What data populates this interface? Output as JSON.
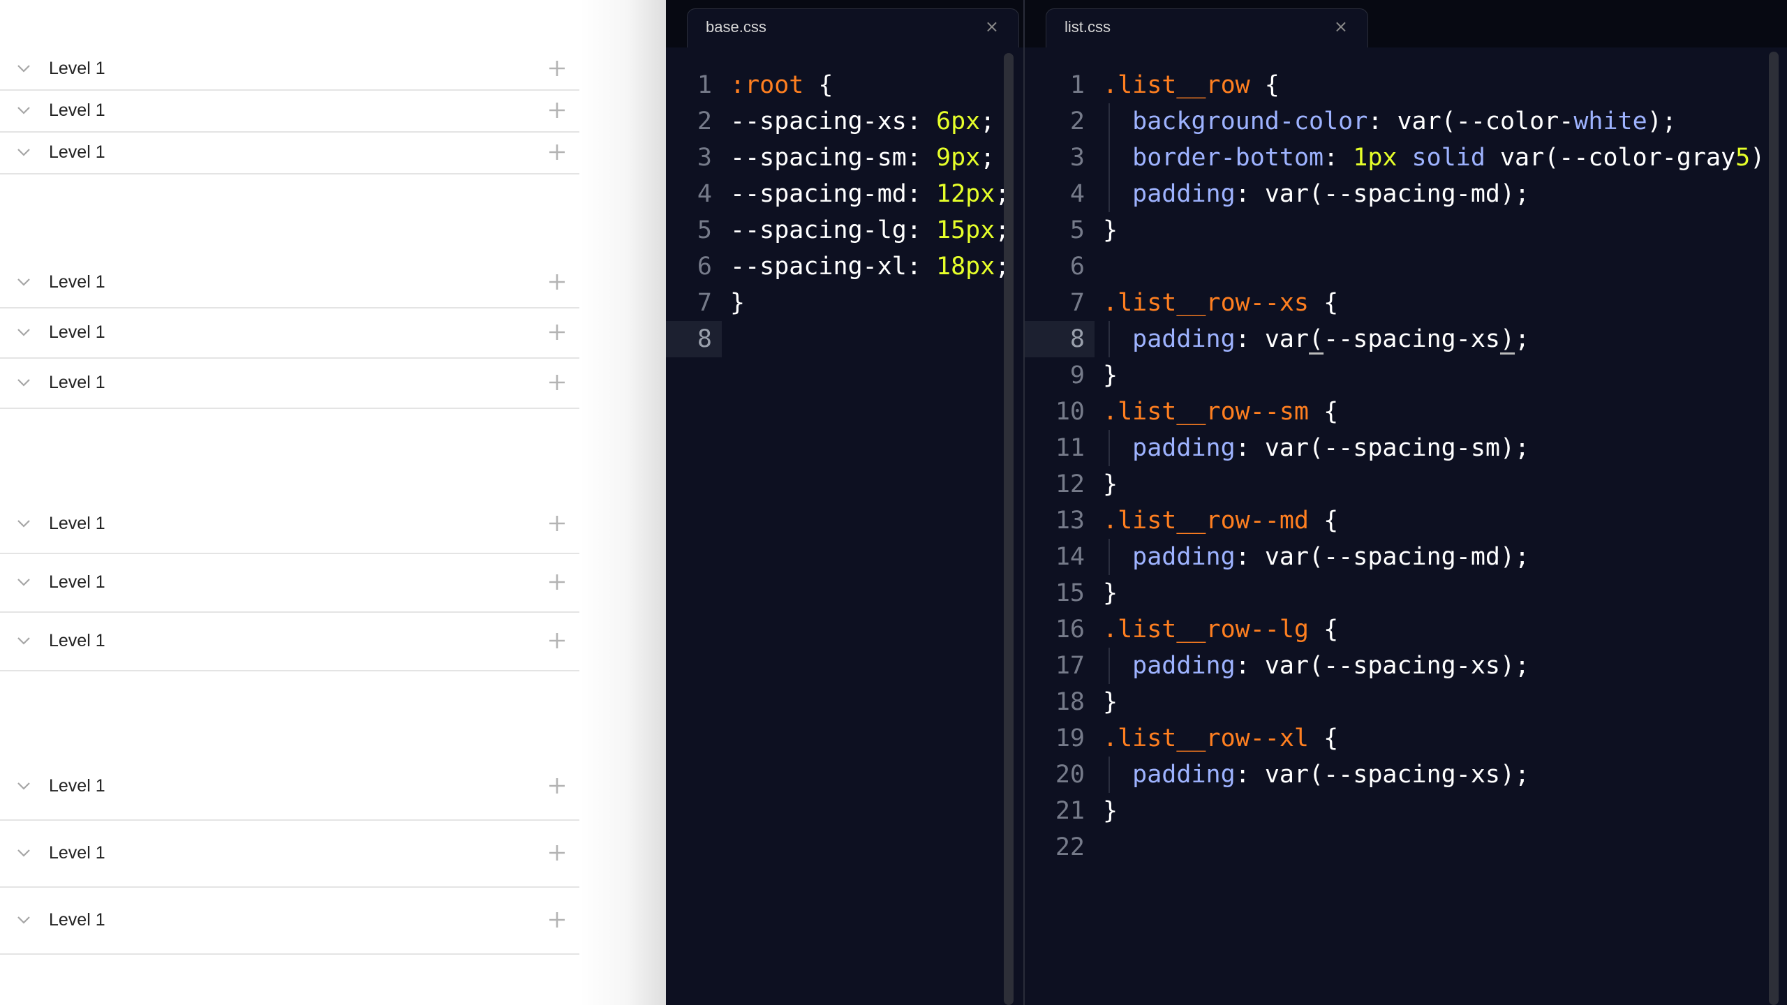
{
  "preview": {
    "groups": [
      {
        "size": "xs",
        "rows": [
          "Level 1",
          "Level 1",
          "Level 1"
        ]
      },
      {
        "size": "sm",
        "rows": [
          "Level 1",
          "Level 1",
          "Level 1"
        ]
      },
      {
        "size": "md",
        "rows": [
          "Level 1",
          "Level 1",
          "Level 1"
        ]
      },
      {
        "size": "xl",
        "rows": [
          "Level 1",
          "Level 1",
          "Level 1"
        ]
      }
    ]
  },
  "editor": {
    "colors": {
      "background": "#0d1021",
      "selector": "#ff7f20",
      "property": "#9eb3ff",
      "number": "#e6ff2a",
      "text": "#ffffff",
      "line_number": "#767b8a"
    },
    "panes": [
      {
        "tab": {
          "name": "base.css",
          "close": "×"
        },
        "current_line": 8,
        "lines": [
          [
            [
              ":root",
              "sel"
            ],
            [
              " {",
              "pun"
            ]
          ],
          [
            [
              "--spacing-xs: ",
              "var"
            ],
            [
              "6px",
              "num"
            ],
            [
              ";",
              "pun"
            ]
          ],
          [
            [
              "--spacing-sm: ",
              "var"
            ],
            [
              "9px",
              "num"
            ],
            [
              ";",
              "pun"
            ]
          ],
          [
            [
              "--spacing-md: ",
              "var"
            ],
            [
              "12px",
              "num"
            ],
            [
              ";",
              "pun"
            ]
          ],
          [
            [
              "--spacing-lg: ",
              "var"
            ],
            [
              "15px",
              "num"
            ],
            [
              ";",
              "pun"
            ]
          ],
          [
            [
              "--spacing-xl: ",
              "var"
            ],
            [
              "18px",
              "num"
            ],
            [
              ";",
              "pun"
            ]
          ],
          [
            [
              "}",
              "pun"
            ]
          ],
          []
        ]
      },
      {
        "tab": {
          "name": "list.css",
          "close": "×"
        },
        "current_line": 8,
        "lines": [
          [
            [
              ".list__row",
              "sel"
            ],
            [
              " {",
              "pun"
            ]
          ],
          [
            [
              "  ",
              "pun"
            ],
            [
              "background-color",
              "prop"
            ],
            [
              ": var(--color-",
              "var"
            ],
            [
              "white",
              "prop"
            ],
            [
              ");",
              "pun"
            ]
          ],
          [
            [
              "  ",
              "pun"
            ],
            [
              "border-bottom",
              "prop"
            ],
            [
              ": ",
              "pun"
            ],
            [
              "1px",
              "num"
            ],
            [
              " ",
              "pun"
            ],
            [
              "solid",
              "kw"
            ],
            [
              " var(--color-gray",
              "var"
            ],
            [
              "5",
              "num"
            ],
            [
              ");",
              "pun"
            ]
          ],
          [
            [
              "  ",
              "pun"
            ],
            [
              "padding",
              "prop"
            ],
            [
              ": var(--spacing-md);",
              "var"
            ]
          ],
          [
            [
              "}",
              "pun"
            ]
          ],
          [],
          [
            [
              ".list__row--xs",
              "sel"
            ],
            [
              " {",
              "pun"
            ]
          ],
          [
            [
              "  ",
              "pun"
            ],
            [
              "padding",
              "prop"
            ],
            [
              ": var",
              "var"
            ],
            [
              "(",
              "mb"
            ],
            [
              "--spacing-xs",
              "var"
            ],
            [
              ")",
              "mb"
            ],
            [
              ";",
              "pun"
            ]
          ],
          [
            [
              "}",
              "pun"
            ]
          ],
          [
            [
              ".list__row--sm",
              "sel"
            ],
            [
              " {",
              "pun"
            ]
          ],
          [
            [
              "  ",
              "pun"
            ],
            [
              "padding",
              "prop"
            ],
            [
              ": var(--spacing-sm);",
              "var"
            ]
          ],
          [
            [
              "}",
              "pun"
            ]
          ],
          [
            [
              ".list__row--md",
              "sel"
            ],
            [
              " {",
              "pun"
            ]
          ],
          [
            [
              "  ",
              "pun"
            ],
            [
              "padding",
              "prop"
            ],
            [
              ": var(--spacing-md);",
              "var"
            ]
          ],
          [
            [
              "}",
              "pun"
            ]
          ],
          [
            [
              ".list__row--lg",
              "sel"
            ],
            [
              " {",
              "pun"
            ]
          ],
          [
            [
              "  ",
              "pun"
            ],
            [
              "padding",
              "prop"
            ],
            [
              ": var(--spacing-xs);",
              "var"
            ]
          ],
          [
            [
              "}",
              "pun"
            ]
          ],
          [
            [
              ".list__row--xl",
              "sel"
            ],
            [
              " {",
              "pun"
            ]
          ],
          [
            [
              "  ",
              "pun"
            ],
            [
              "padding",
              "prop"
            ],
            [
              ": var(--spacing-xs);",
              "var"
            ]
          ],
          [
            [
              "}",
              "pun"
            ]
          ],
          []
        ]
      }
    ]
  }
}
